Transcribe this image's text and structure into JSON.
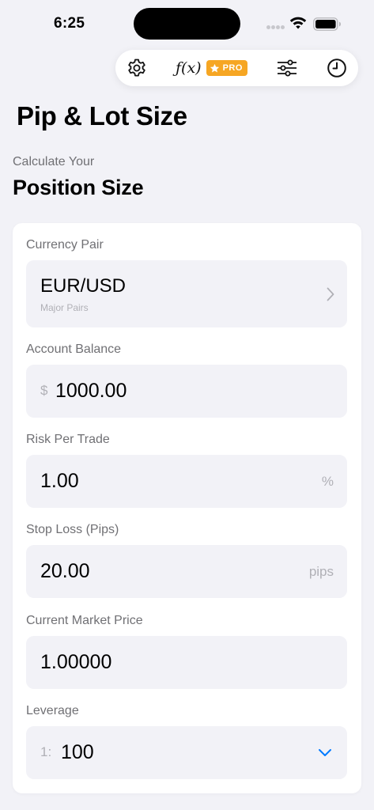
{
  "status_bar": {
    "time": "6:25"
  },
  "toolbar": {
    "fx_label": "ƒ(x)",
    "pro_badge": "PRO",
    "icons": [
      "gear-icon",
      "function-icon",
      "star-icon",
      "sliders-icon",
      "clock-icon"
    ]
  },
  "header": {
    "title": "Pip & Lot Size",
    "subtitle": "Calculate Your",
    "section_title": "Position Size"
  },
  "form": {
    "currency_pair": {
      "label": "Currency Pair",
      "value": "EUR/USD",
      "category": "Major Pairs"
    },
    "account_balance": {
      "label": "Account Balance",
      "prefix": "$",
      "value": "1000.00"
    },
    "risk_per_trade": {
      "label": "Risk Per Trade",
      "value": "1.00",
      "suffix": "%"
    },
    "stop_loss": {
      "label": "Stop Loss (Pips)",
      "value": "20.00",
      "suffix": "pips"
    },
    "market_price": {
      "label": "Current Market Price",
      "value": "1.00000"
    },
    "leverage": {
      "label": "Leverage",
      "prefix": "1:",
      "value": "100"
    }
  },
  "colors": {
    "background": "#f2f2f7",
    "card": "#ffffff",
    "field": "#f2f2f7",
    "label": "#707074",
    "placeholder": "#b0b0b6",
    "accent": "#007aff",
    "pro_badge": "#f6a623"
  }
}
